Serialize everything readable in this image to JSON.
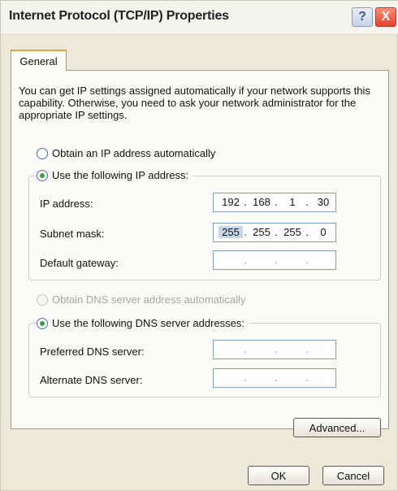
{
  "window": {
    "title": "Internet Protocol (TCP/IP) Properties",
    "help_glyph": "?",
    "close_glyph": "X"
  },
  "tabs": [
    {
      "label": "General",
      "selected": true
    }
  ],
  "description": "You can get IP settings assigned automatically if your network supports this capability. Otherwise, you need to ask your network administrator for the appropriate IP settings.",
  "ip_mode": {
    "auto_label": "Obtain an IP address automatically",
    "auto_checked": false,
    "manual_label": "Use the following IP address:",
    "manual_checked": true
  },
  "ip_fields": {
    "ip_address": {
      "label": "IP address:",
      "octets": [
        "192",
        "168",
        "1",
        "30"
      ]
    },
    "subnet_mask": {
      "label": "Subnet mask:",
      "octets": [
        "255",
        "255",
        "255",
        "0"
      ],
      "selected_octet_index": 0
    },
    "default_gateway": {
      "label": "Default gateway:",
      "octets": [
        "",
        "",
        "",
        ""
      ]
    }
  },
  "dns_mode": {
    "auto_label": "Obtain DNS server address automatically",
    "auto_checked": false,
    "auto_disabled": true,
    "manual_label": "Use the following DNS server addresses:",
    "manual_checked": true
  },
  "dns_fields": {
    "preferred": {
      "label": "Preferred DNS server:",
      "octets": [
        "",
        "",
        "",
        ""
      ]
    },
    "alternate": {
      "label": "Alternate DNS server:",
      "octets": [
        "",
        "",
        "",
        ""
      ]
    }
  },
  "buttons": {
    "advanced": "Advanced...",
    "ok": "OK",
    "cancel": "Cancel"
  },
  "ip_separator": "."
}
